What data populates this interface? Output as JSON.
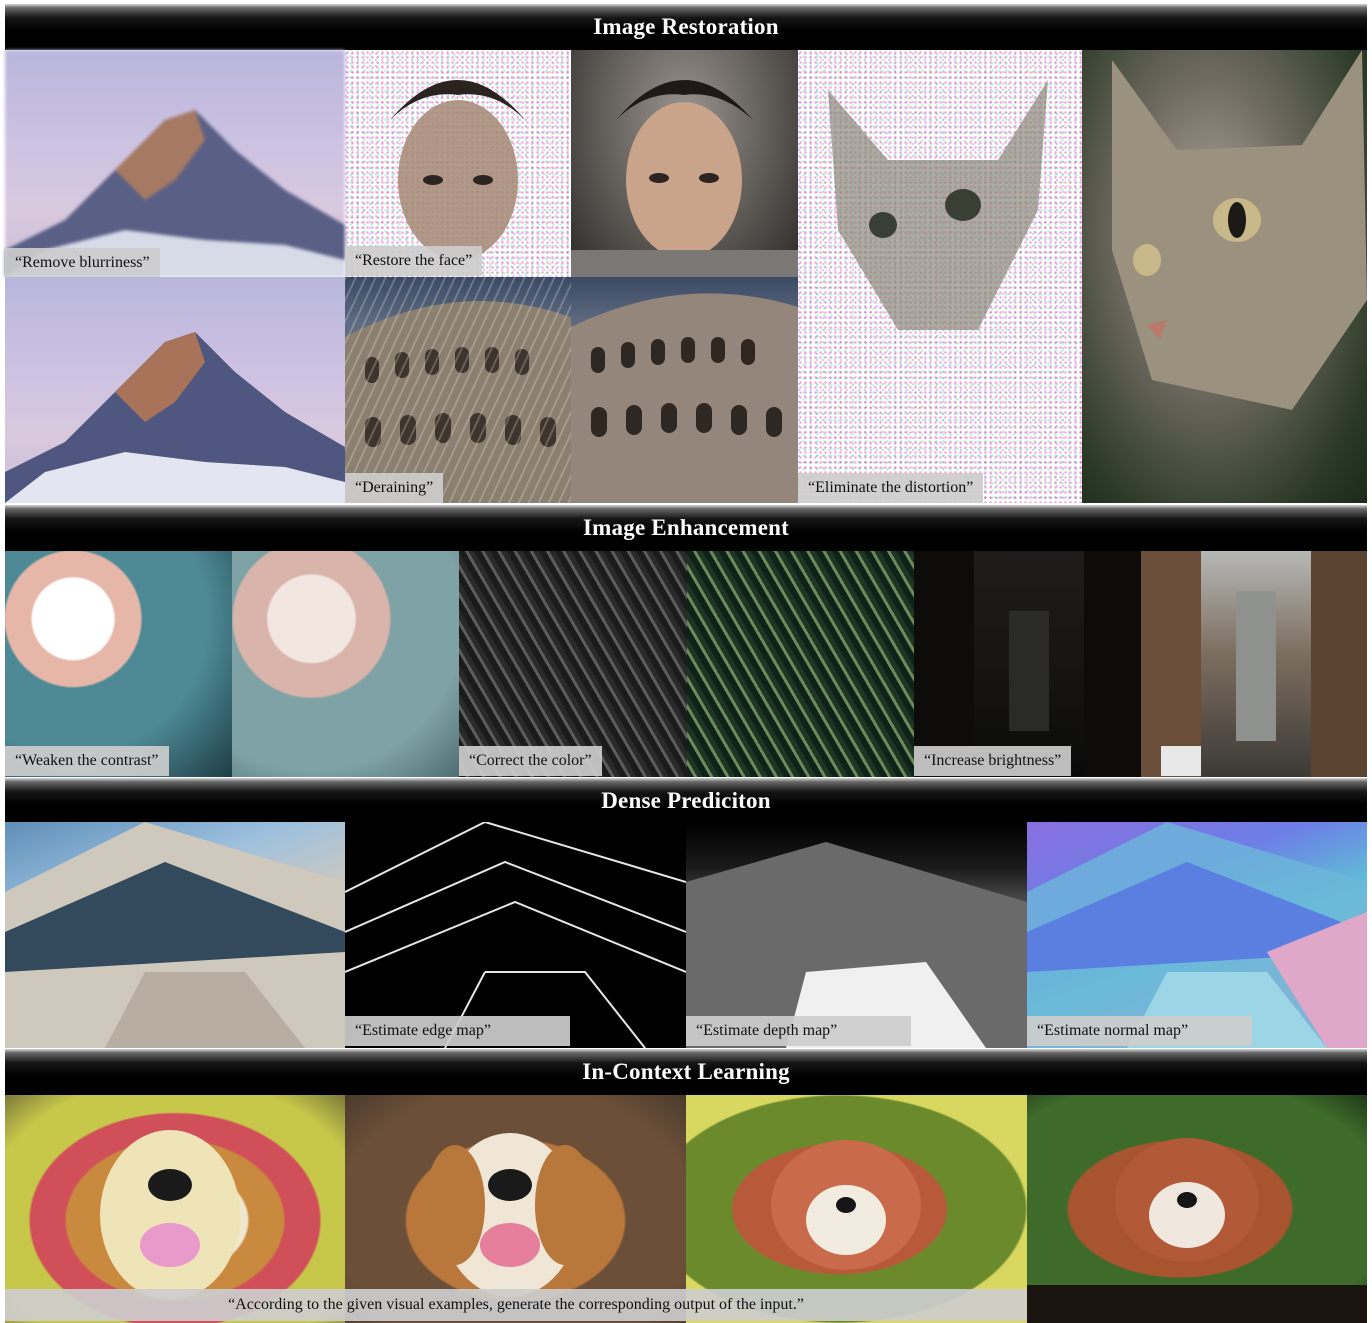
{
  "sections": {
    "restoration": "Image Restoration",
    "enhancement": "Image Enhancement",
    "dense": "Dense Prediciton",
    "icl": "In-Context Learning"
  },
  "captions": {
    "deblur": "“Remove blurriness”",
    "face": "“Restore the face”",
    "derain": "“Deraining”",
    "distortion": "“Eliminate the distortion”",
    "contrast": "“Weaken the contrast”",
    "color": "“Correct the color”",
    "brightness": "“Increase brightness”",
    "edge": "“Estimate edge map”",
    "depth": "“Estimate depth map”",
    "normal": "“Estimate normal map”",
    "icl": "“According to the given visual examples, generate the corresponding output of the input.”"
  }
}
